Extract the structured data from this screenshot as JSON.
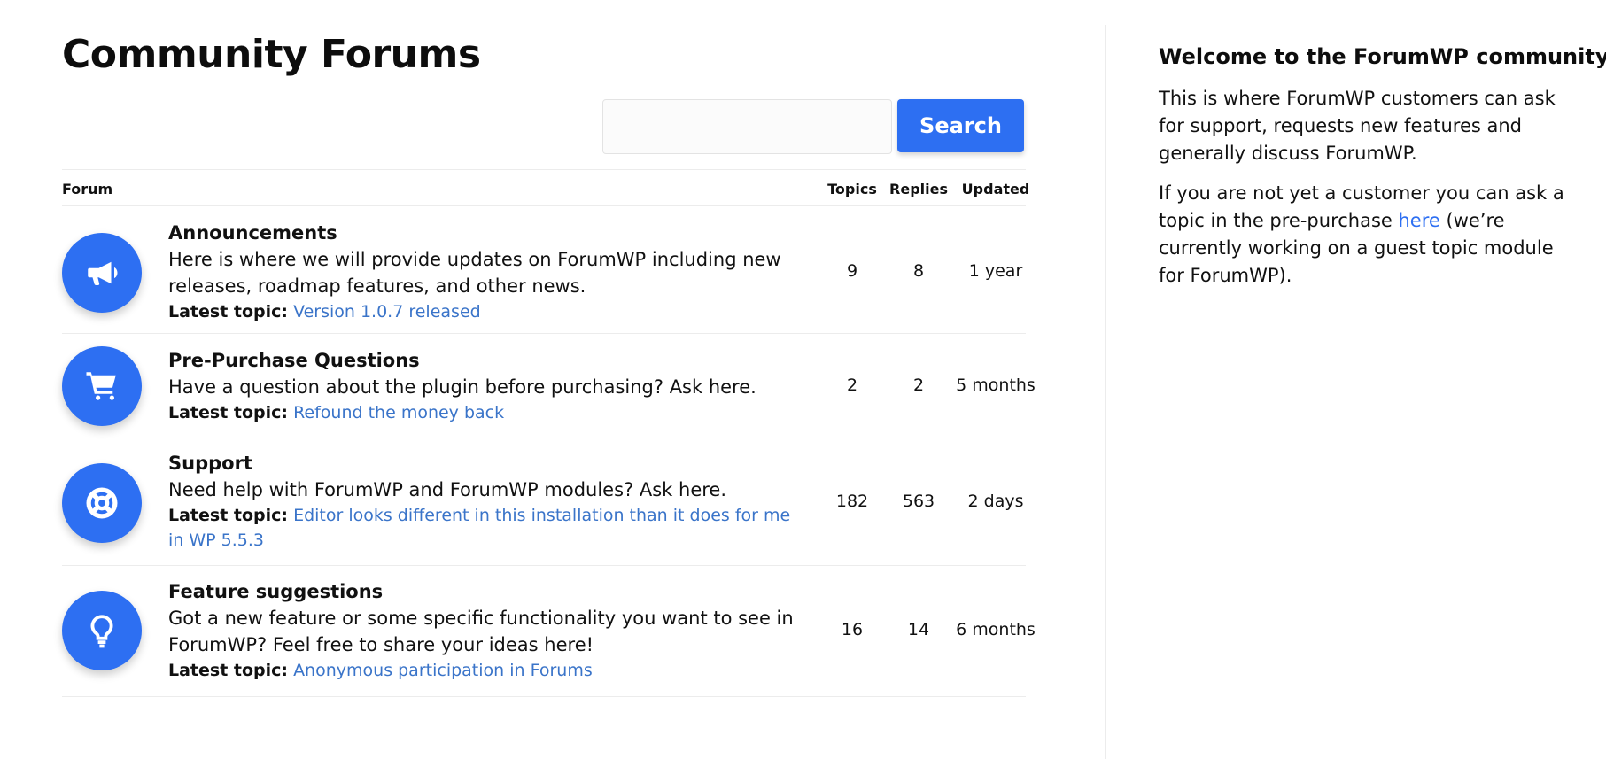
{
  "page": {
    "title": "Community Forums"
  },
  "search": {
    "placeholder": "",
    "value": "",
    "button_label": "Search"
  },
  "table": {
    "headers": {
      "forum": "Forum",
      "topics": "Topics",
      "replies": "Replies",
      "updated": "Updated"
    },
    "latest_label": "Latest topic:",
    "rows": [
      {
        "icon": "megaphone-icon",
        "title": "Announcements",
        "description": "Here is where we will provide updates on ForumWP including new releases, roadmap features, and other news.",
        "latest_topic": "Version 1.0.7 released",
        "topics": "9",
        "replies": "8",
        "updated": "1 year"
      },
      {
        "icon": "cart-icon",
        "title": "Pre-Purchase Questions",
        "description": "Have a question about the plugin before purchasing? Ask here.",
        "latest_topic": "Refound the money back",
        "topics": "2",
        "replies": "2",
        "updated": "5 months"
      },
      {
        "icon": "lifebuoy-icon",
        "title": "Support",
        "description": "Need help with ForumWP and ForumWP modules? Ask here.",
        "latest_topic": "Editor looks different in this installation than it does for me in WP 5.5.3",
        "topics": "182",
        "replies": "563",
        "updated": "2 days"
      },
      {
        "icon": "lightbulb-icon",
        "title": "Feature suggestions",
        "description": "Got a new feature or some specific functionality you want to see in ForumWP? Feel free to share your ideas here!",
        "latest_topic": "Anonymous participation in Forums",
        "topics": "16",
        "replies": "14",
        "updated": "6 months"
      }
    ]
  },
  "sidebar": {
    "title": "Welcome to the ForumWP community",
    "paragraph1": "This is where ForumWP customers can ask for support, requests new features and generally discuss ForumWP.",
    "paragraph2_before": "If you are not yet a customer you can ask a topic in the pre-purchase ",
    "paragraph2_link": "here",
    "paragraph2_after": " (we’re currently working on a guest topic module for ForumWP)."
  },
  "colors": {
    "accent": "#2d6ff2",
    "link": "#3a74c9"
  }
}
